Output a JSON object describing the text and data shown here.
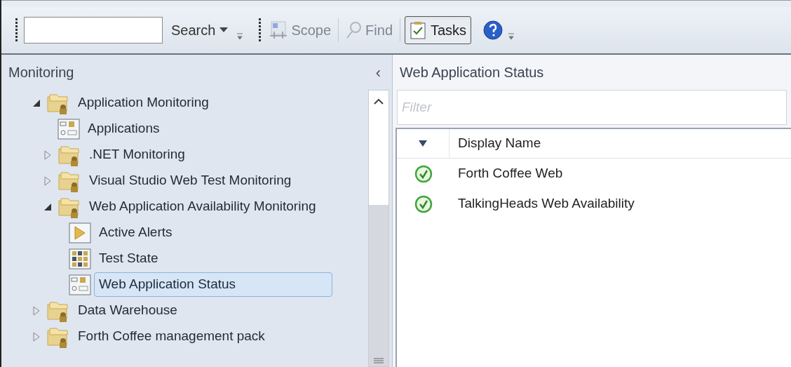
{
  "toolbar": {
    "search_button": "Search",
    "scope_button": {
      "label": "Scope",
      "disabled": true
    },
    "find_button": {
      "label": "Find",
      "disabled": true
    },
    "tasks_button": {
      "label": "Tasks",
      "pressed": true
    }
  },
  "navigation": {
    "title": "Monitoring",
    "collapse_glyph": "‹",
    "tree": [
      {
        "label": "Application Monitoring",
        "kind": "folder",
        "expanded": true,
        "selected": false,
        "children": [
          {
            "label": "Applications",
            "kind": "state-view",
            "selected": false
          },
          {
            "label": ".NET Monitoring",
            "kind": "folder",
            "expanded": false,
            "selected": false
          },
          {
            "label": "Visual Studio Web Test Monitoring",
            "kind": "folder",
            "expanded": false,
            "selected": false
          },
          {
            "label": "Web Application Availability Monitoring",
            "kind": "folder",
            "expanded": true,
            "selected": false,
            "children": [
              {
                "label": "Active Alerts",
                "kind": "alert-view",
                "selected": false
              },
              {
                "label": "Test State",
                "kind": "grid-view",
                "selected": false
              },
              {
                "label": "Web Application Status",
                "kind": "state-view",
                "selected": true
              }
            ]
          }
        ]
      },
      {
        "label": "Data Warehouse",
        "kind": "folder",
        "expanded": false,
        "selected": false
      },
      {
        "label": "Forth Coffee management pack",
        "kind": "folder",
        "expanded": false,
        "selected": false
      }
    ]
  },
  "results": {
    "title": "Web Application Status",
    "filter": {
      "placeholder": "Filter"
    },
    "columns": [
      "Display Name"
    ],
    "rows": [
      {
        "kind": "healthy",
        "display_name": "Forth Coffee Web"
      },
      {
        "kind": "healthy",
        "display_name": "TalkingHeads Web Availability"
      }
    ]
  }
}
